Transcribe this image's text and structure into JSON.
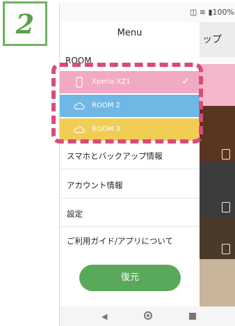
{
  "step": {
    "number": "2"
  },
  "status_bar": {
    "battery": "100%"
  },
  "background": {
    "header_text": "ップ"
  },
  "drawer": {
    "title": "Menu",
    "room_label": "ROOM",
    "rooms": [
      {
        "label": "Xperia XZ1",
        "icon": "phone-icon",
        "color": "#f2a9c4",
        "selected": true
      },
      {
        "label": "ROOM 2",
        "icon": "cloud-icon",
        "color": "#6fb8e6"
      },
      {
        "label": "ROOM 3",
        "icon": "cloud-icon",
        "color": "#f2cd56"
      }
    ],
    "menu_items": [
      "スマホとバックアップ情報",
      "アカウント情報",
      "設定",
      "ご利用ガイド/アプリについて"
    ],
    "restore_label": "復元"
  },
  "colors": {
    "highlight": "#d94b7a",
    "step_green": "#6fb35e",
    "restore_green": "#5aa95a"
  }
}
